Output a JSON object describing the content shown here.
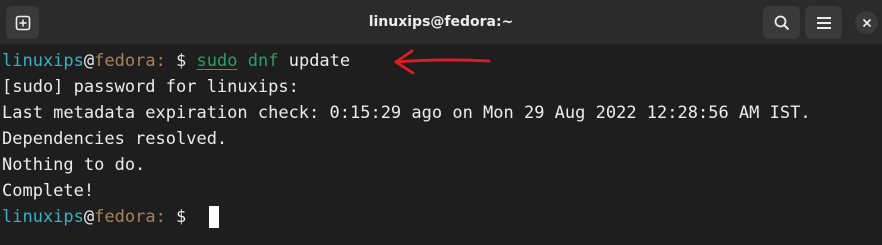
{
  "window": {
    "title": "linuxips@fedora:~"
  },
  "prompt": {
    "user": "linuxips",
    "at": "@",
    "host": "fedora",
    "path": ": ",
    "symbol": "$"
  },
  "lines": {
    "cmd_sudo": "sudo",
    "cmd_dnf": "dnf",
    "cmd_update": "update",
    "l2": "[sudo] password for linuxips:",
    "l3": "Last metadata expiration check: 0:15:29 ago on Mon 29 Aug 2022 12:28:56 AM IST.",
    "l4": "Dependencies resolved.",
    "l5": "Nothing to do.",
    "l6": "Complete!"
  },
  "colors": {
    "background": "#1e1e1e",
    "titlebar": "#2b2b2b",
    "user": "#33b2c8",
    "host": "#a8815a",
    "command": "#26a269",
    "annotation_arrow": "#e01b24"
  },
  "icons": {
    "new_tab": "new-tab-icon",
    "search": "search-icon",
    "menu": "hamburger-menu-icon",
    "close": "close-icon",
    "annotation": "red-arrow-annotation"
  }
}
